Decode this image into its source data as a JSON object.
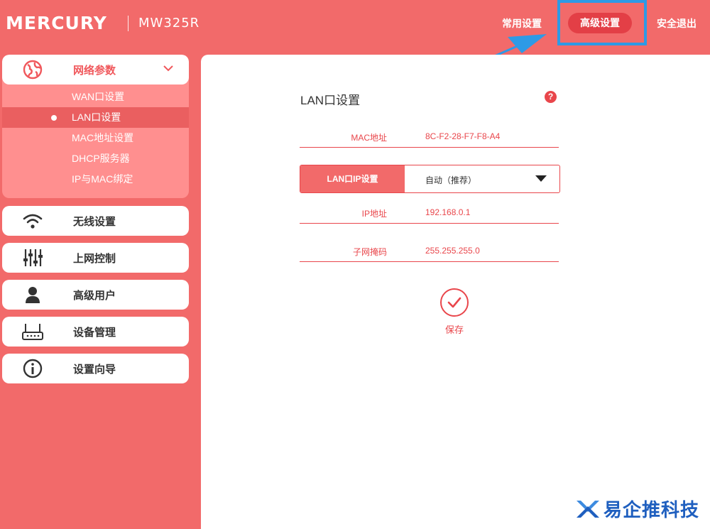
{
  "header": {
    "brand": "MERCURY",
    "model": "MW325R",
    "nav_common": "常用设置",
    "nav_advanced": "高级设置",
    "nav_logout": "安全退出"
  },
  "sidebar": {
    "group": {
      "label": "网络参数",
      "icon": "globe-icon",
      "items": [
        {
          "label": "WAN口设置",
          "active": false
        },
        {
          "label": "LAN口设置",
          "active": true
        },
        {
          "label": "MAC地址设置",
          "active": false
        },
        {
          "label": "DHCP服务器",
          "active": false
        },
        {
          "label": "IP与MAC绑定",
          "active": false
        }
      ]
    },
    "items": [
      {
        "label": "无线设置",
        "icon": "wifi-icon"
      },
      {
        "label": "上网控制",
        "icon": "sliders-icon"
      },
      {
        "label": "高级用户",
        "icon": "user-icon"
      },
      {
        "label": "设备管理",
        "icon": "router-icon"
      },
      {
        "label": "设置向导",
        "icon": "info-icon"
      }
    ]
  },
  "main": {
    "title": "LAN口设置",
    "help": "?",
    "mac": {
      "label": "MAC地址",
      "value": "8C-F2-28-F7-F8-A4"
    },
    "ip_mode": {
      "label": "LAN口IP设置",
      "value": "自动（推荐）"
    },
    "ip": {
      "label": "IP地址",
      "value": "192.168.0.1"
    },
    "mask": {
      "label": "子网掩码",
      "value": "255.255.255.0"
    },
    "save_label": "保存"
  },
  "watermark": {
    "text": "易企推科技"
  },
  "colors": {
    "background": "#f26a6a",
    "accent": "#e9464b",
    "active_pill": "#e33f46",
    "highlight": "#2e9ae6",
    "watermark": "#1f5fbf"
  }
}
